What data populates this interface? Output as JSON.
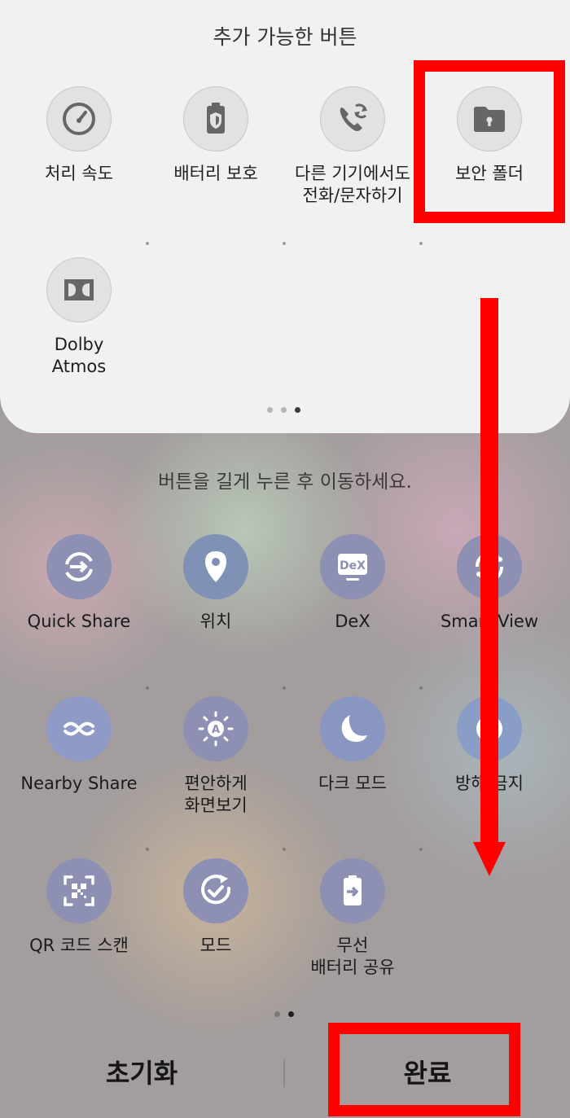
{
  "top_panel": {
    "title": "추가 가능한 버튼",
    "items": [
      {
        "label": "처리 속도",
        "icon": "speedometer-icon"
      },
      {
        "label": "배터리 보호",
        "icon": "battery-shield-icon"
      },
      {
        "label": "다른 기기에서도\n전화/문자하기",
        "icon": "phone-sync-icon"
      },
      {
        "label": "보안 폴더",
        "icon": "secure-folder-icon"
      },
      {
        "label": "Dolby\nAtmos",
        "icon": "dolby-icon"
      }
    ],
    "page_indicator": {
      "count": 3,
      "active": 2
    }
  },
  "hint": "버튼을 길게 누른 후 이동하세요.",
  "grid": {
    "items": [
      {
        "label": "Quick Share",
        "icon": "quick-share-icon"
      },
      {
        "label": "위치",
        "icon": "location-pin-icon"
      },
      {
        "label": "DeX",
        "icon": "dex-icon"
      },
      {
        "label": "Smart View",
        "icon": "smart-view-icon"
      },
      {
        "label": "Nearby Share",
        "icon": "nearby-share-icon"
      },
      {
        "label": "편안하게\n화면보기",
        "icon": "eye-comfort-icon"
      },
      {
        "label": "다크 모드",
        "icon": "moon-icon"
      },
      {
        "label": "방해 금지",
        "icon": "do-not-disturb-icon"
      },
      {
        "label": "QR 코드 스캔",
        "icon": "qr-scan-icon"
      },
      {
        "label": "모드",
        "icon": "modes-icon"
      },
      {
        "label": "무선\n배터리 공유",
        "icon": "wireless-battery-share-icon"
      }
    ],
    "page_indicator": {
      "count": 2,
      "active": 1
    }
  },
  "bottom": {
    "reset_label": "초기화",
    "done_label": "완료"
  },
  "colors": {
    "annotation_red": "#ff0000",
    "tile_circle": "#8d8fb3"
  }
}
